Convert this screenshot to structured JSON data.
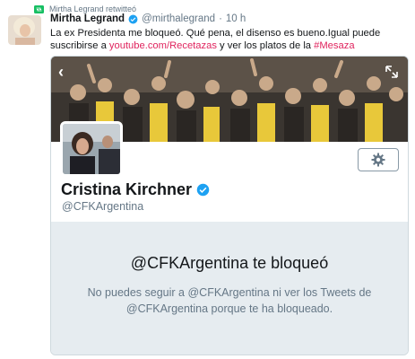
{
  "retweet": {
    "label": "Mirtha Legrand retwitteó",
    "icon": "retweet-icon"
  },
  "tweet": {
    "author_name": "Mirtha Legrand",
    "handle": "@mirthalegrand",
    "separator": "·",
    "time": "10 h",
    "text_line1": "La ex Presidenta me bloqueó. Qué pena, el disenso es bueno.Igual puede",
    "text_line2_prefix": "suscribirse a ",
    "link": "youtube.com/Recetazas",
    "text_line2_mid": " y ver los platos de la ",
    "hashtag": "#Mesaza"
  },
  "card": {
    "profile_name": "Cristina Kirchner",
    "profile_handle": "@CFKArgentina",
    "blocked_title": "@CFKArgentina te bloqueó",
    "blocked_message": "No puedes seguir a @CFKArgentina ni ver los Tweets de @CFKArgentina porque te ha bloqueado."
  },
  "colors": {
    "link": "#e0245e",
    "verified": "#1da1f2",
    "muted": "#657786",
    "panel": "#e6ecf0"
  }
}
